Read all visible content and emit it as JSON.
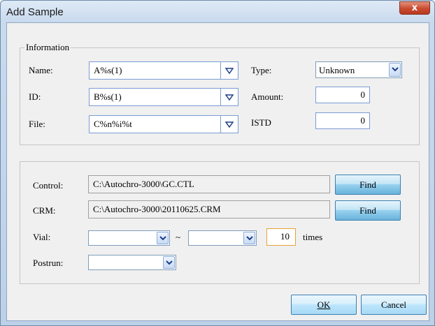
{
  "window": {
    "title": "Add Sample",
    "close_glyph": "x"
  },
  "information": {
    "caption": "Information",
    "name": {
      "label": "Name:",
      "value": "A%s(1)"
    },
    "id": {
      "label": "ID:",
      "value": "B%s(1)"
    },
    "file": {
      "label": "File:",
      "value": "C%n%i%t"
    },
    "type": {
      "label": "Type:",
      "value": "Unknown"
    },
    "amount": {
      "label": "Amount:",
      "value": "0"
    },
    "istd": {
      "label": "ISTD",
      "value": "0"
    }
  },
  "settings": {
    "control": {
      "label": "Control:",
      "value": "C:\\Autochro-3000\\GC.CTL",
      "button": "Find"
    },
    "crm": {
      "label": "CRM:",
      "value": "C:\\Autochro-3000\\20110625.CRM",
      "button": "Find"
    },
    "vial": {
      "label": "Vial:",
      "from": "",
      "separator": "~",
      "to": "",
      "times_value": "10",
      "times_label": "times"
    },
    "postrun": {
      "label": "Postrun:",
      "value": ""
    }
  },
  "buttons": {
    "ok": "OK",
    "cancel": "Cancel"
  },
  "icons": {
    "combo_arrow": "triangle-down-icon",
    "select_arrow": "chevron-down-icon"
  },
  "colors": {
    "accent": "#3c7fb1",
    "field_border": "#7a9cd3",
    "close": "#c84a2f"
  }
}
